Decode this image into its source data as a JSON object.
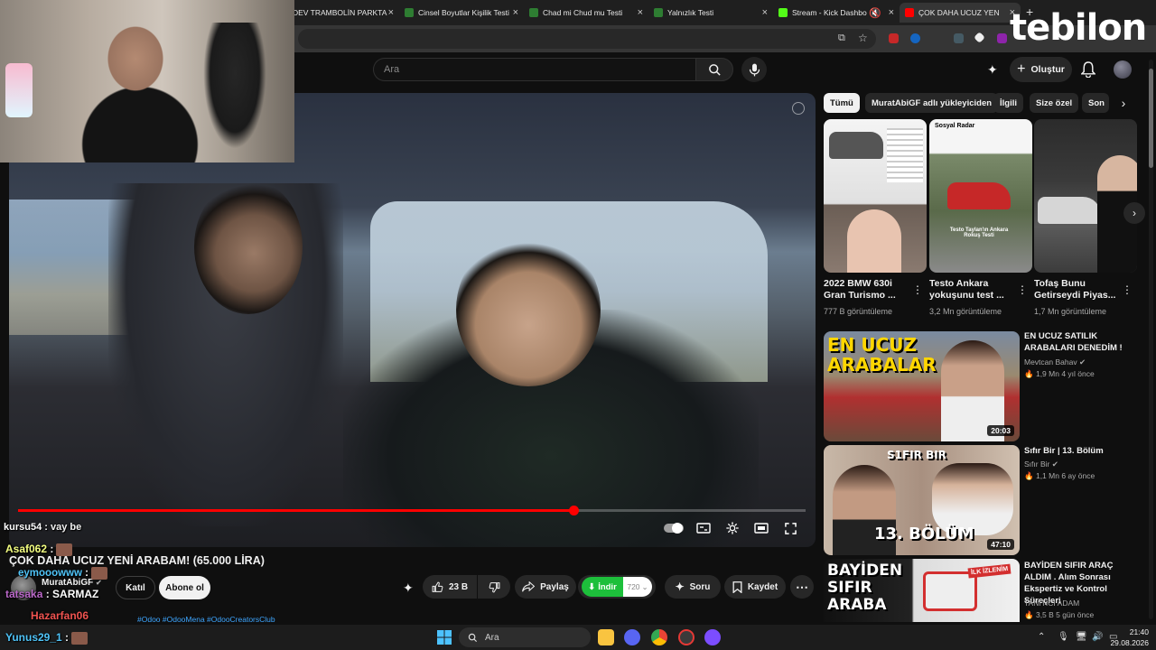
{
  "browser": {
    "tabs": [
      {
        "label": "DEV TRAMBOLİN PARKTA",
        "color": "#d32f2f"
      },
      {
        "label": "Cinsel Boyutlar Kişilik Testi",
        "color": "#2e7d32"
      },
      {
        "label": "Chad mi Chud mu Testi",
        "color": "#2e7d32"
      },
      {
        "label": "Yalnızlık Testi",
        "color": "#2e7d32"
      },
      {
        "label": "Stream - Kick Dashbo",
        "color": "#53fc18"
      },
      {
        "label": "ÇOK DAHA UCUZ YEN",
        "color": "#ff0000"
      }
    ],
    "new_tab": "+"
  },
  "logo": {
    "text": "tebilon",
    "accent": "#e91e63"
  },
  "header": {
    "search_placeholder": "Ara",
    "create_label": "Oluştur"
  },
  "player": {
    "progress": 0.705,
    "accent": "#ff0000"
  },
  "video": {
    "title": "ÇOK DAHA UCUZ YENİ ARABAM! (65.000 LİRA)",
    "channel": "MuratAbiGF",
    "join_label": "Katıl",
    "subscribe_label": "Abone ol",
    "like_count": "23 B",
    "share_label": "Paylaş",
    "download_label": "İndir",
    "quality": "720",
    "ask_label": "Soru",
    "save_label": "Kaydet",
    "tags": "#Odoo #OdooMena #OdooCreatorsClub",
    "download_color": "#1dbf3b"
  },
  "chat": [
    {
      "user": "kursu54",
      "text": "vay be",
      "color": "#ffffff"
    },
    {
      "user": "Asaf062",
      "text": "",
      "color": "#f4ff81"
    },
    {
      "user": "eymooowww",
      "text": "",
      "color": "#4fc3f7"
    },
    {
      "user": "tatsaka",
      "text": "SARMAZ",
      "color": "#ba68c8"
    },
    {
      "user": "Hazarfan06",
      "text": "",
      "color": "#ef5350"
    },
    {
      "user": "Yunus29_1",
      "text": "",
      "color": "#4fc3f7"
    }
  ],
  "sidebar": {
    "chips": [
      "Tümü",
      "MuratAbiGF adlı yükleyiciden",
      "İlgili",
      "Size özel",
      "Son"
    ],
    "shorts": [
      {
        "title": "2022 BMW 630i Gran Turismo ...",
        "views": "777 B görüntüleme"
      },
      {
        "title": "Testo Ankara yokuşunu test ...",
        "views": "3,2 Mn görüntüleme"
      },
      {
        "title": "Tofaş Bunu Getirseydi Piyas...",
        "views": "1,7 Mn görüntüleme"
      }
    ],
    "short_texts": [
      "Sosyal Radar",
      "Testo Taylan'ın Ankara Rokuş Testi"
    ],
    "videos": [
      {
        "title": "EN UCUZ SATILIK ARABALARI DENEDİM !",
        "channel": "Mevtcan Bahav",
        "meta": "1,9 Mn  4 yıl önce",
        "duration": "20:03",
        "thumb_text": "EN UCUZ ARABALAR"
      },
      {
        "title": "Sıfır Bir | 13. Bölüm",
        "channel": "Sıfır Bir",
        "meta": "1,1 Mn  6 ay önce",
        "duration": "47:10",
        "thumb_text": "13. BÖLÜM",
        "thumb_top": "S1FIR BIR"
      },
      {
        "title": "BAYİDEN SIFIR ARAÇ ALDIM . Alım Sonrası Ekspertiz ve Kontrol Süreçleri",
        "channel": "TANITICI ADAM",
        "meta": "3,5 B  5 gün önce",
        "duration": "",
        "thumb_text": "BAYİDEN SIFIR ARABA",
        "badge": "İLK İZLENİM"
      }
    ]
  },
  "taskbar": {
    "search_placeholder": "Ara",
    "time": "21:40",
    "date": "29.08.2026"
  }
}
